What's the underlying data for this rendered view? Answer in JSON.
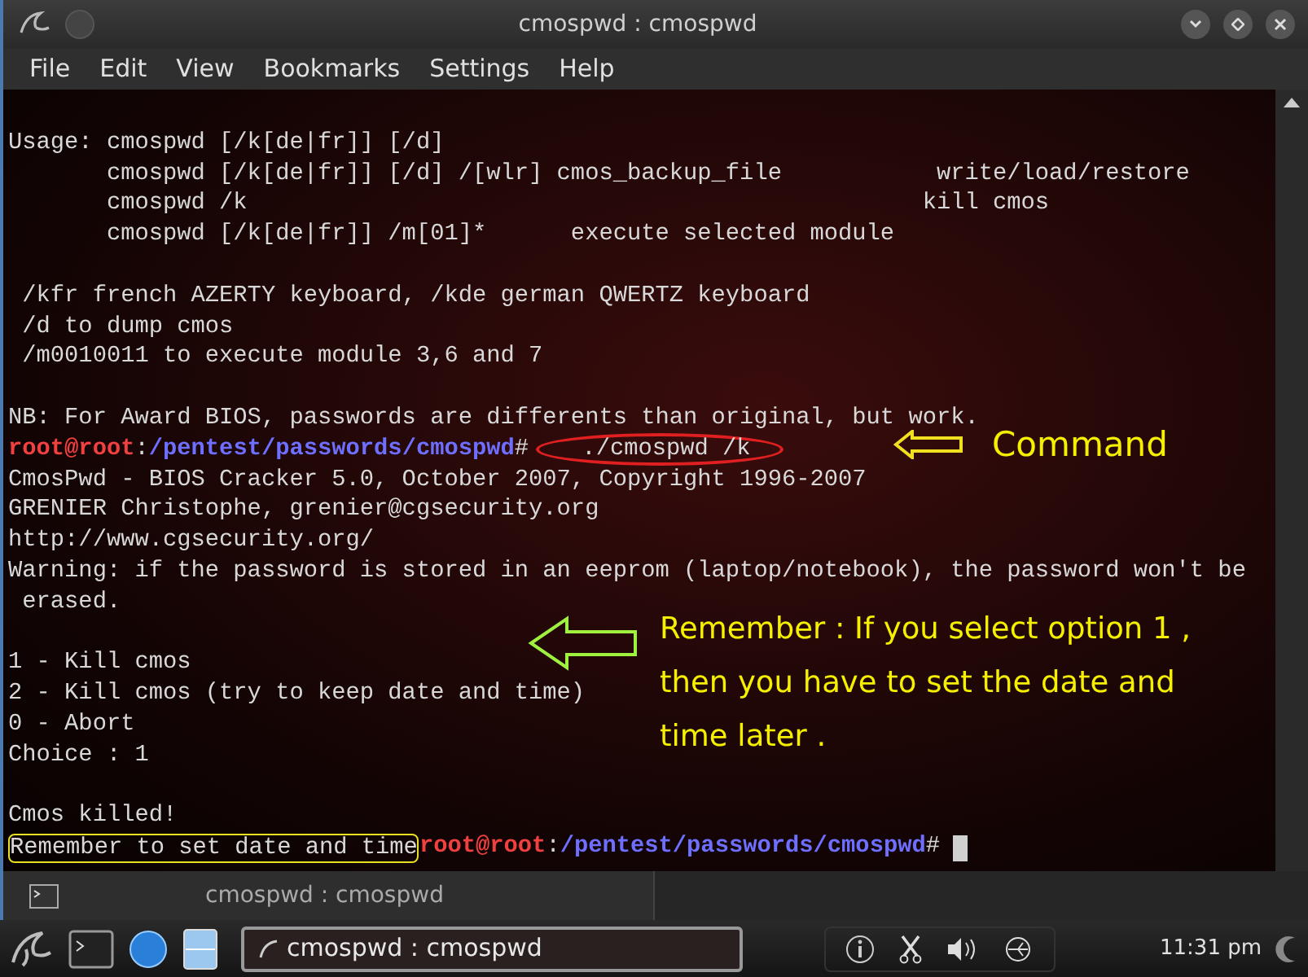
{
  "window": {
    "title": "cmospwd : cmospwd"
  },
  "menu": [
    "File",
    "Edit",
    "View",
    "Bookmarks",
    "Settings",
    "Help"
  ],
  "terminal": {
    "lines": [
      {
        "kind": "blank"
      },
      {
        "kind": "text",
        "text": "Usage: cmospwd [/k[de|fr]] [/d]"
      },
      {
        "kind": "text",
        "text": "       cmospwd [/k[de|fr]] [/d] /[wlr] cmos_backup_file           write/load/restore"
      },
      {
        "kind": "text",
        "text": "       cmospwd /k                                                kill cmos"
      },
      {
        "kind": "text",
        "text": "       cmospwd [/k[de|fr]] /m[01]*      execute selected module"
      },
      {
        "kind": "blank"
      },
      {
        "kind": "text",
        "text": " /kfr french AZERTY keyboard, /kde german QWERTZ keyboard"
      },
      {
        "kind": "text",
        "text": " /d to dump cmos"
      },
      {
        "kind": "text",
        "text": " /m0010011 to execute module 3,6 and 7"
      },
      {
        "kind": "blank"
      },
      {
        "kind": "text",
        "text": "NB: For Award BIOS, passwords are differents than original, but work."
      },
      {
        "kind": "prompt",
        "user": "root@root",
        "separator": ":",
        "path": "/pentest/passwords/cmospwd",
        "symbol": "#",
        "command": " ./cmospwd /k"
      },
      {
        "kind": "text",
        "text": "CmosPwd - BIOS Cracker 5.0, October 2007, Copyright 1996-2007"
      },
      {
        "kind": "text",
        "text": "GRENIER Christophe, grenier@cgsecurity.org"
      },
      {
        "kind": "text",
        "text": "http://www.cgsecurity.org/"
      },
      {
        "kind": "text",
        "text": "Warning: if the password is stored in an eeprom (laptop/notebook), the password won't be"
      },
      {
        "kind": "text",
        "text": " erased."
      },
      {
        "kind": "blank"
      },
      {
        "kind": "text",
        "text": "1 - Kill cmos"
      },
      {
        "kind": "text",
        "text": "2 - Kill cmos (try to keep date and time)"
      },
      {
        "kind": "text",
        "text": "0 - Abort"
      },
      {
        "kind": "text",
        "text": "Choice : 1"
      },
      {
        "kind": "blank"
      },
      {
        "kind": "text",
        "text": "Cmos killed!"
      },
      {
        "kind": "prompt",
        "prefix": "Remember to set date and time",
        "user": "root@root",
        "separator": ":",
        "path": "/pentest/passwords/cmospwd",
        "symbol": "#",
        "cursor": true
      }
    ]
  },
  "annotations": [
    {
      "kind": "command",
      "text": "Command"
    },
    {
      "kind": "remember",
      "text": "Remember : If you select option 1 , then you have to set the date and time later ."
    }
  ],
  "tab_bar": {
    "tabs": [
      {
        "label": "cmospwd : cmospwd",
        "selected": true
      }
    ]
  },
  "taskbar": {
    "task": "cmospwd : cmospwd",
    "clock": "11:31 pm"
  }
}
